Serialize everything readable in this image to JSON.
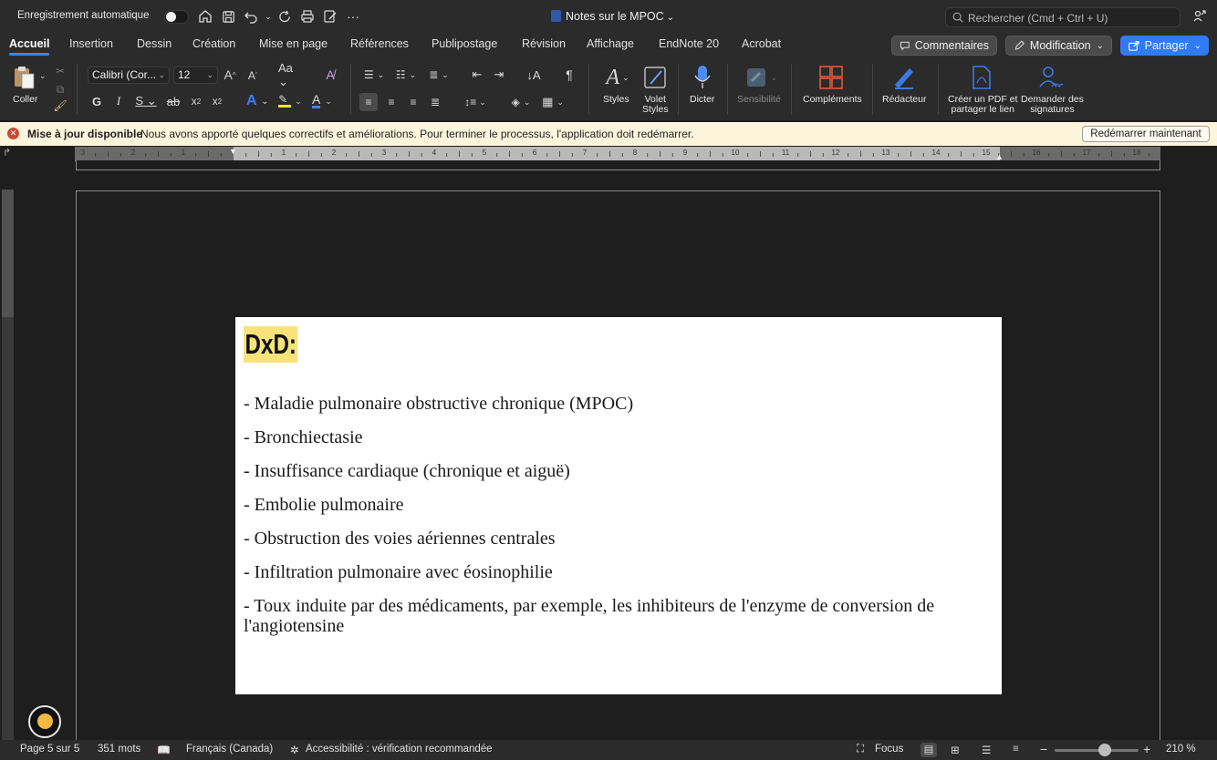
{
  "titlebar": {
    "autosave_label": "Enregistrement automatique",
    "doc_title": "Notes sur le MPOC",
    "search_placeholder": "Rechercher (Cmd + Ctrl + U)"
  },
  "tabs": [
    {
      "label": "Accueil",
      "active": true
    },
    {
      "label": "Insertion"
    },
    {
      "label": "Dessin"
    },
    {
      "label": "Création"
    },
    {
      "label": "Mise en page"
    },
    {
      "label": "Références"
    },
    {
      "label": "Publipostage"
    },
    {
      "label": "Révision"
    },
    {
      "label": "Affichage"
    },
    {
      "label": "EndNote 20"
    },
    {
      "label": "Acrobat"
    }
  ],
  "actions": {
    "comments": "Commentaires",
    "editing": "Modification",
    "share": "Partager"
  },
  "ribbon": {
    "paste": "Coller",
    "font_name": "Calibri (Cor...",
    "font_size": "12",
    "styles": "Styles",
    "styles_pane_1": "Volet",
    "styles_pane_2": "Styles",
    "dictate": "Dicter",
    "sensitivity": "Sensibilité",
    "addins": "Compléments",
    "editor": "Rédacteur",
    "pdf_1": "Créer un PDF et",
    "pdf_2": "partager le lien",
    "signatures_1": "Demander des",
    "signatures_2": "signatures"
  },
  "infobar": {
    "title": "Mise à jour disponible",
    "message": "Nous avons apporté quelques correctifs et améliorations. Pour terminer le processus, l'application doit  redémarrer.",
    "button": "Redémarrer maintenant"
  },
  "document": {
    "heading": "DxD:",
    "items": [
      "- Maladie pulmonaire obstructive chronique (MPOC)",
      "- Bronchiectasie",
      "- Insuffisance cardiaque (chronique et aiguë)",
      "- Embolie pulmonaire",
      "- Obstruction des voies aériennes centrales",
      "- Infiltration pulmonaire avec éosinophilie",
      "- Toux induite par des médicaments, par exemple, les inhibiteurs de l'enzyme de conversion de l'angiotensine"
    ]
  },
  "status": {
    "page": "Page 5 sur 5",
    "words": "351 mots",
    "language": "Français (Canada)",
    "accessibility": "Accessibilité : vérification recommandée",
    "focus": "Focus",
    "zoom": "210 %"
  },
  "colors": {
    "accent": "#3b82f6",
    "highlight": "#f7e37a",
    "infobar_bg": "#fdf4dc",
    "share_button": "#2f7cf6"
  }
}
